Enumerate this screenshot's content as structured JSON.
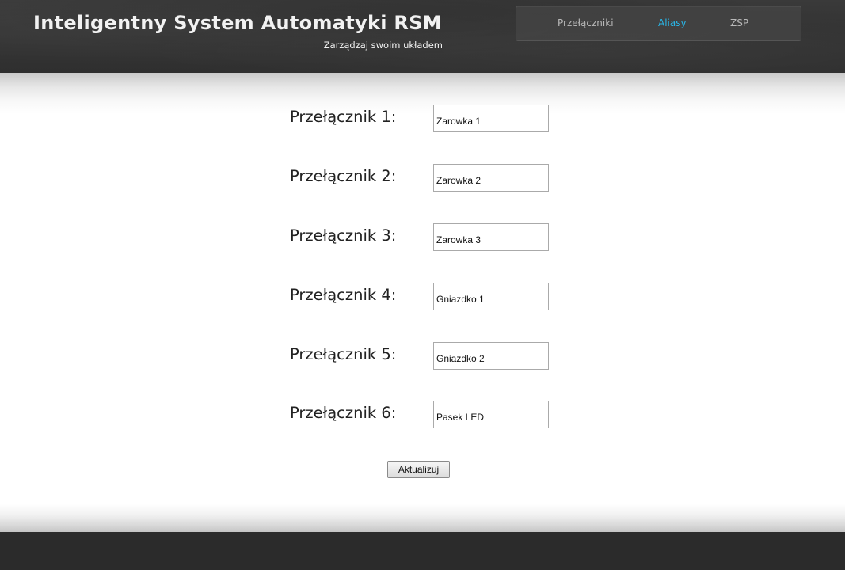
{
  "header": {
    "title": "Inteligentny System Automatyki RSM",
    "subtitle": "Zarządzaj swoim układem"
  },
  "nav": {
    "items": [
      {
        "label": "Przełączniki",
        "active": false
      },
      {
        "label": "Aliasy",
        "active": true
      },
      {
        "label": "ZSP",
        "active": false
      }
    ],
    "active_color": "#29b6e8"
  },
  "aliases": [
    {
      "label": "Przełącznik 1:",
      "value": "Zarowka 1"
    },
    {
      "label": "Przełącznik 2:",
      "value": "Zarowka 2"
    },
    {
      "label": "Przełącznik 3:",
      "value": "Zarowka 3"
    },
    {
      "label": "Przełącznik 4:",
      "value": "Gniazdko 1"
    },
    {
      "label": "Przełącznik 5:",
      "value": "Gniazdko 2"
    },
    {
      "label": "Przełącznik 6:",
      "value": "Pasek LED"
    }
  ],
  "form": {
    "submit_label": "Aktualizuj"
  }
}
